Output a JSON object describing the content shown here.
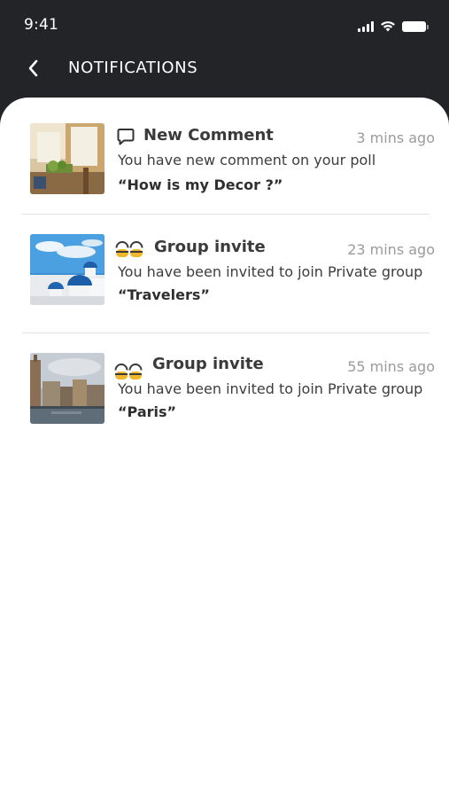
{
  "status_bar": {
    "time": "9:41"
  },
  "header": {
    "title": "NOTIFICATIONS"
  },
  "notifications": [
    {
      "type": "comment",
      "title": "New Comment",
      "time": "3 mins ago",
      "message": "You have new comment on your poll",
      "highlight": "“How is my Decor ?”"
    },
    {
      "type": "group-invite",
      "title": "Group invite",
      "time": "23 mins ago",
      "message": "You have been invited to join Private group ",
      "highlight": "“Travelers”"
    },
    {
      "type": "group-invite",
      "title": "Group invite",
      "time": "55 mins ago",
      "message": "You have been invited to join Private group ",
      "highlight": "“Paris”"
    }
  ],
  "colors": {
    "header_bg": "#232427",
    "group_icon": "#f0b72a",
    "time_text": "#9b9b9b"
  }
}
